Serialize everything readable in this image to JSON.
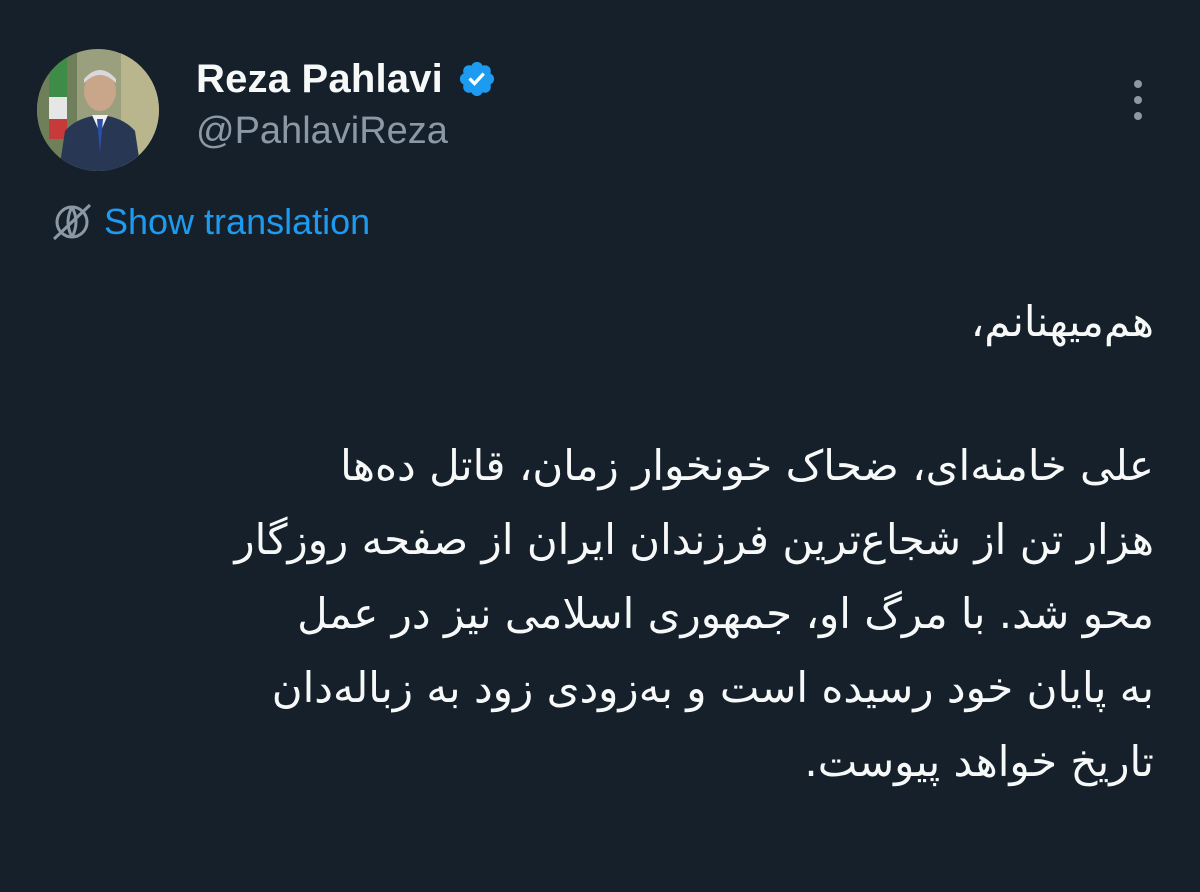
{
  "author": {
    "display_name": "Reza Pahlavi",
    "handle": "@PahlaviReza",
    "verified": true,
    "avatar": "profile-photo"
  },
  "actions": {
    "show_translation": "Show translation",
    "translate_icon": "translate-globe-icon",
    "more_icon": "more-vertical-icon"
  },
  "tweet": {
    "greeting": "هم‌میهنانم،",
    "lines": [
      "علی خامنه‌ای، ضحاک خونخوار زمان، قاتل ده‌ها",
      "هزار تن از شجاع‌ترین فرزندان ایران از صفحه روزگار",
      "محو شد. با مرگ او، جمهوری اسلامی نیز در عمل",
      "به پایان خود رسیده است و به‌زودی زود به زباله‌دان",
      "تاریخ خواهد پیوست."
    ]
  },
  "colors": {
    "background": "#15202b",
    "text_primary": "#f7f9f9",
    "text_secondary": "#8b98a5",
    "accent": "#1d9bf0"
  }
}
